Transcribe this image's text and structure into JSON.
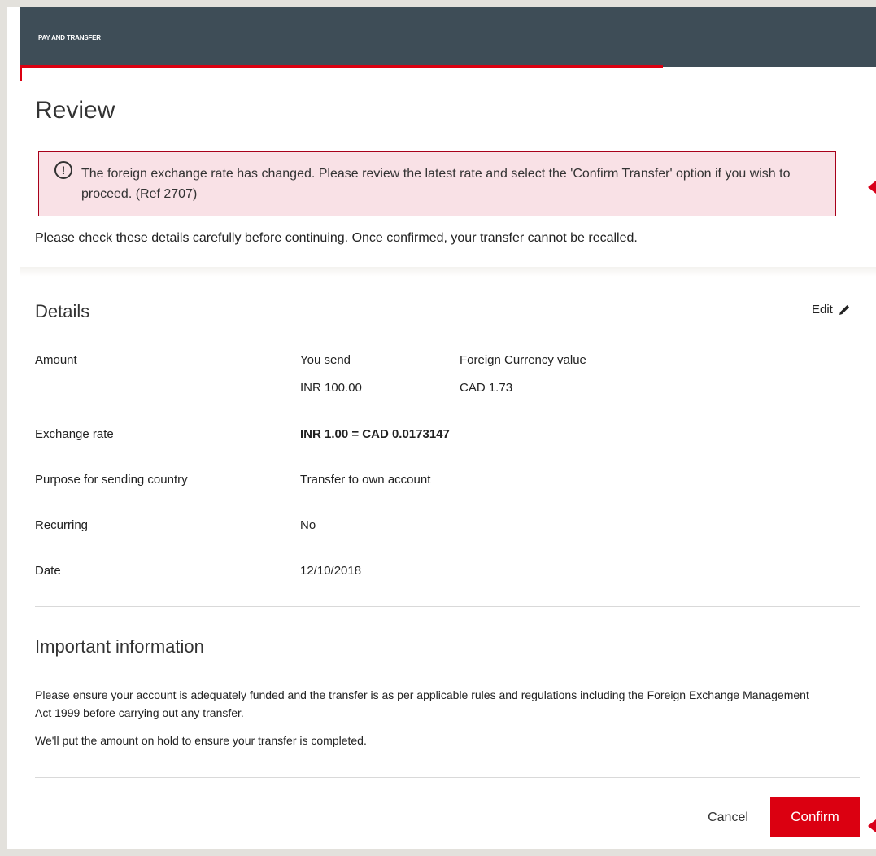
{
  "header": {
    "title": "PAY AND TRANSFER"
  },
  "page": {
    "title": "Review"
  },
  "alert": {
    "icon": "exclamation-circle-icon",
    "message": "The foreign exchange rate has changed. Please review the latest rate and select the 'Confirm Transfer' option if you wish to proceed. (Ref 2707)"
  },
  "intro": "Please check these details carefully before continuing. Once confirmed, your transfer cannot be recalled.",
  "details": {
    "title": "Details",
    "edit_label": "Edit",
    "amount": {
      "label": "Amount",
      "send_heading": "You send",
      "send_value": "INR 100.00",
      "foreign_heading": "Foreign Currency value",
      "foreign_value": "CAD 1.73"
    },
    "exchange_rate": {
      "label": "Exchange rate",
      "value": "INR 1.00 = CAD 0.0173147"
    },
    "purpose": {
      "label": "Purpose for sending country",
      "value": "Transfer to own account"
    },
    "recurring": {
      "label": "Recurring",
      "value": "No"
    },
    "date": {
      "label": "Date",
      "value": "12/10/2018"
    }
  },
  "important": {
    "title": "Important information",
    "paragraph1": "Please ensure your account is adequately funded and the transfer is as per applicable rules and regulations including the Foreign Exchange Management Act 1999 before carrying out any transfer.",
    "paragraph2": "We'll put the amount on hold to ensure your transfer is completed."
  },
  "actions": {
    "cancel_label": "Cancel",
    "confirm_label": "Confirm"
  },
  "colors": {
    "brand_red": "#db0011",
    "header_bg": "#3e4d57",
    "alert_bg": "#f9e1e6"
  }
}
